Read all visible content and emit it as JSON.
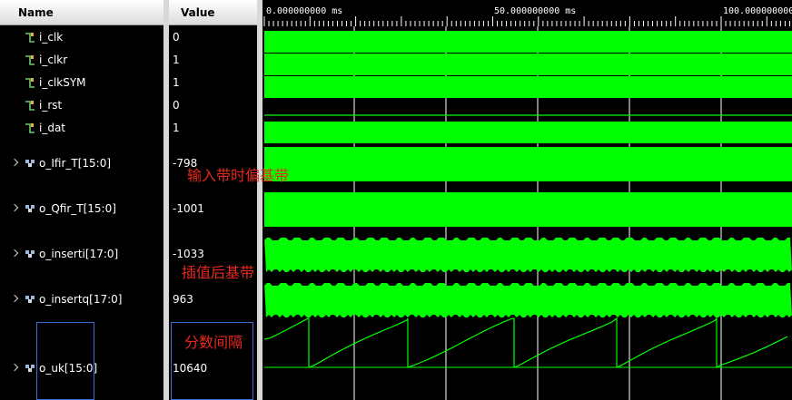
{
  "columns": {
    "name": "Name",
    "value": "Value"
  },
  "signals": [
    {
      "id": "i_clk",
      "label": "i_clk",
      "value": "0",
      "type": "bit"
    },
    {
      "id": "i_clkr",
      "label": "i_clkr",
      "value": "1",
      "type": "bit"
    },
    {
      "id": "i_clksym",
      "label": "i_clkSYM",
      "value": "1",
      "type": "bit"
    },
    {
      "id": "i_rst",
      "label": "i_rst",
      "value": "0",
      "type": "bit"
    },
    {
      "id": "i_dat",
      "label": "i_dat",
      "value": "1",
      "type": "bit"
    },
    {
      "id": "o_ifir_t",
      "label": "o_Ifir_T[15:0]",
      "value": "-798",
      "type": "bus"
    },
    {
      "id": "o_qfir_t",
      "label": "o_Qfir_T[15:0]",
      "value": "-1001",
      "type": "bus"
    },
    {
      "id": "o_inserti",
      "label": "o_inserti[17:0]",
      "value": "-1033",
      "type": "bus"
    },
    {
      "id": "o_insertq",
      "label": "o_insertq[17:0]",
      "value": "963",
      "type": "bus"
    },
    {
      "id": "o_uk",
      "label": "o_uk[15:0]",
      "value": "10640",
      "type": "bus"
    }
  ],
  "timeline": {
    "labels": [
      "0.000000000 ms",
      "50.000000000 ms",
      "100.000000000"
    ]
  },
  "annotations": {
    "baseband_input": "输入带时偏基带",
    "interpolated": "插值后基带",
    "fractional_interval": "分数间隔"
  },
  "colors": {
    "waveform": "#00ff00",
    "annotation": "#e8281e",
    "highlight_box": "#3a6fd8",
    "background": "#000000"
  },
  "icons": {
    "bit": "bit-signal-icon",
    "bus": "bus-signal-icon",
    "expand": "expand-caret-icon"
  }
}
